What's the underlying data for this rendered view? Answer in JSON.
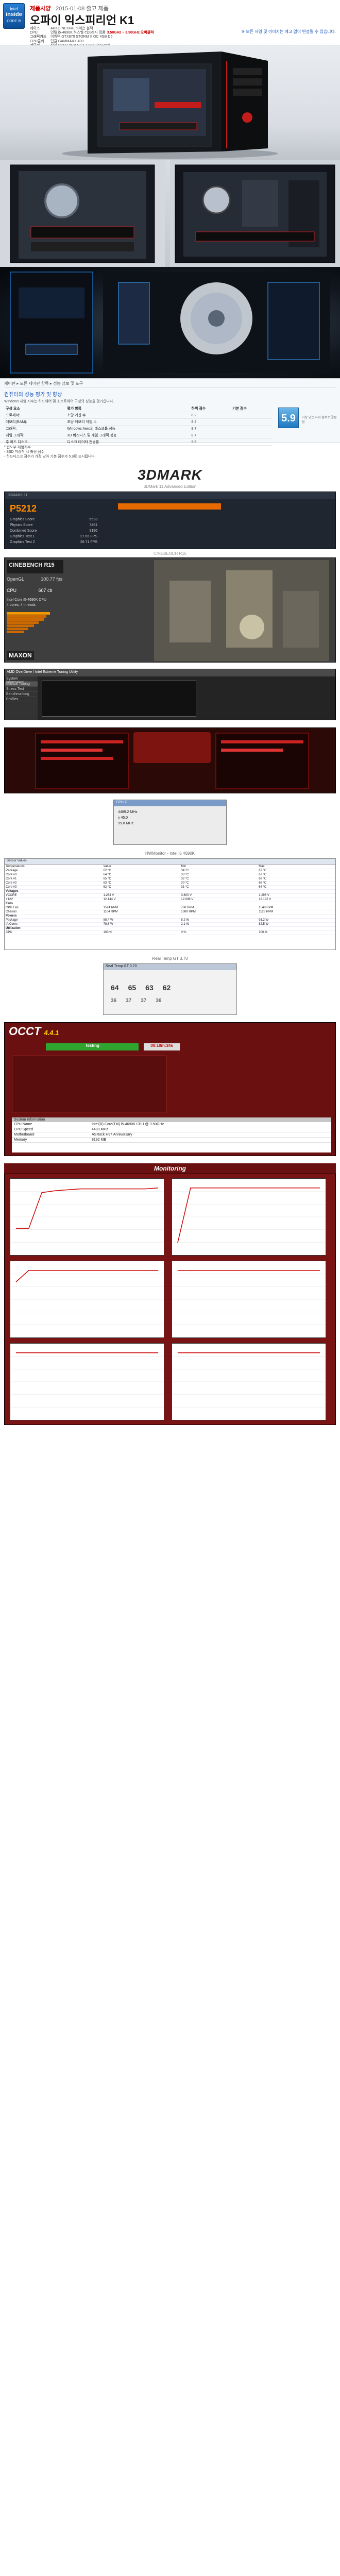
{
  "header": {
    "badge_top": "intel",
    "badge_inside": "inside",
    "badge_brand": "CORE i5",
    "tag": "제품사양",
    "date": "2015-01-08 출고 제품",
    "title": "오파이 익스피리언 K1",
    "note": "※ 모든 사양 및 이미지는 예고 없이 변경될 수 있습니다.",
    "specs": [
      {
        "k": "케이스",
        "v": "ABKO NCORE 바이슨 블랙"
      },
      {
        "k": "CPU",
        "v": "인텔 i5-4690K 하스웰 리프레시 정품",
        "hl": "3.50GHz ~ 3.90GHz 오버클럭"
      },
      {
        "k": "그래픽카드",
        "v": "이엠텍 GTX970 STORM X OC 4GB D5"
      },
      {
        "k": "CPU쿨러",
        "v": "딥쿨 GAMMAXX 400"
      },
      {
        "k": "메모리",
        "v": "삼성 DDR3 8GB PC3-12800 (4GB×2)"
      },
      {
        "k": "파워",
        "v": "마이크로닉스 Classic II 600W 80PLUS"
      },
      {
        "k": "SSD/HDD",
        "v": "샌디스크 SSD 120GB / WD 1TB"
      },
      {
        "k": "메인보드",
        "v": "ASRock H97 Anniversary"
      },
      {
        "k": "CPU/VGA",
        "v": "CPU 오버 / VGA 오버"
      }
    ]
  },
  "photos": {
    "ph1_caption": "",
    "ph2_caption": "",
    "ph3_caption": ""
  },
  "wex": {
    "crumb": "제어판 ▸ 모든 제어판 항목 ▸ 성능 정보 및 도구",
    "heading": "컴퓨터의 성능 평가 및 향상",
    "intro": "Windows 체험 지수는 하드웨어 및 소프트웨어 구성의 성능을 평가합니다.",
    "cols": [
      "구성 요소",
      "평가 항목",
      "하위 점수",
      "기본 점수"
    ],
    "rows": [
      [
        "프로세서:",
        "초당 계산 수",
        "8.2"
      ],
      [
        "메모리(RAM):",
        "초당 메모리 작업 수",
        "8.2"
      ],
      [
        "그래픽:",
        "Windows Aero의 데스크톱 성능",
        "8.7"
      ],
      [
        "게임 그래픽:",
        "3D 비즈니스 및 게임 그래픽 성능",
        "8.7"
      ],
      [
        "주 하드 디스크:",
        "디스크 데이터 전송률",
        "5.9"
      ]
    ],
    "base_score": "5.9",
    "base_caption": "가장 낮은 하위 점수로 결정됨"
  },
  "notes_sm": [
    "* 윈도우 체험지수",
    "- SSD 미장착 시 측정 점수",
    "- 하드디스크 점수가 가장 낮아 기본 점수가 5.9로 표시됩니다."
  ],
  "dmark": {
    "logo": "3DMARK",
    "sub": "3DMark 11 Advanced Edition",
    "topbar": "3DMARK 11",
    "score": "P5212",
    "rows": [
      [
        "Graphics Score",
        "5523"
      ],
      [
        "Physics Score",
        "7461"
      ],
      [
        "Combined Score",
        "3196"
      ],
      [
        "Graphics Test 1",
        "27.65 FPS"
      ],
      [
        "Graphics Test 2",
        "26.71 FPS"
      ]
    ]
  },
  "cinebench": {
    "caption": "CINEBENCH R15",
    "brand": "CINEBENCH R15",
    "opengl_label": "OpenGL",
    "opengl_value": "100.77 fps",
    "cpu_label": "CPU",
    "cpu_value": "607 cb",
    "processor": "Intel Core i5-4690K CPU",
    "cores": "4 cores, 4 threads",
    "maxon": "MAXON"
  },
  "overdrive": {
    "title": "AMD OverDrive / Intel Extreme Tuning Utility",
    "menu": [
      "System Information",
      "Manual Tuning",
      "Stress Test",
      "Benchmarking",
      "Profiles"
    ],
    "active_index": 1
  },
  "cpuz": {
    "title": "CPU-Z",
    "core_speed": "4489.2 MHz",
    "multiplier": "x 45.0",
    "bus": "99.8 MHz"
  },
  "hwmon": {
    "caption": "HWMonitor - Intel i5 4690K",
    "tab": "Sensor Values",
    "rows": [
      [
        "Temperatures",
        "Value",
        "Min",
        "Max"
      ],
      [
        "Package",
        "62 °C",
        "34 °C",
        "67 °C"
      ],
      [
        "Core #0",
        "64 °C",
        "33 °C",
        "67 °C"
      ],
      [
        "Core #1",
        "65 °C",
        "32 °C",
        "68 °C"
      ],
      [
        "Core #2",
        "63 °C",
        "30 °C",
        "66 °C"
      ],
      [
        "Core #3",
        "62 °C",
        "31 °C",
        "64 °C"
      ],
      [
        "Voltages",
        "",
        "",
        ""
      ],
      [
        "VCORE",
        "1.264 V",
        "0.800 V",
        "1.296 V"
      ],
      [
        "+12V",
        "12.144 V",
        "12.096 V",
        "12.192 V"
      ],
      [
        "Fans",
        "",
        "",
        ""
      ],
      [
        "CPU Fan",
        "1524 RPM",
        "768 RPM",
        "1548 RPM"
      ],
      [
        "Chassis",
        "1104 RPM",
        "1080 RPM",
        "1126 RPM"
      ],
      [
        "Powers",
        "",
        "",
        ""
      ],
      [
        "Package",
        "88.4 W",
        "8.2 W",
        "91.2 W"
      ],
      [
        "IA Cores",
        "79.6 W",
        "2.1 W",
        "82.5 W"
      ],
      [
        "Utilization",
        "",
        "",
        ""
      ],
      [
        "CPU",
        "100 %",
        "0 %",
        "100 %"
      ]
    ]
  },
  "realtemp": {
    "caption": "Real Temp GT 3.70",
    "title": "Real Temp GT 3.70",
    "temps": [
      "64",
      "65",
      "63",
      "62"
    ],
    "mins": [
      "36",
      "37",
      "37",
      "36"
    ]
  },
  "occt": {
    "logo": "OCCT",
    "ver": "4.4.1",
    "status": "Testing",
    "elapsed": "00:10m:34s",
    "sys_title": "System Information",
    "sys_rows": [
      [
        "CPU Name",
        "Intel(R) Core(TM) i5-4690K CPU @ 3.50GHz"
      ],
      [
        "CPU Speed",
        "4489 MHz"
      ],
      [
        "Motherboard",
        "ASRock H97 Anniversary"
      ],
      [
        "Memory",
        "8192 MB"
      ]
    ],
    "monitoring": "Monitoring"
  },
  "monitor_graphs": [
    [
      22,
      22,
      60,
      62,
      63,
      64,
      64,
      64,
      64,
      64,
      64,
      65
    ],
    [
      10,
      100,
      100,
      100,
      100,
      100,
      100,
      100,
      100,
      100,
      100,
      100
    ],
    [
      1.02,
      1.26,
      1.26,
      1.26,
      1.26,
      1.26,
      1.26,
      1.26,
      1.26,
      1.26,
      1.26,
      1.26
    ],
    [
      12.1,
      12.1,
      12.1,
      12.1,
      12.1,
      12.1,
      12.1,
      12.1,
      12.1,
      12.1,
      12.1,
      12.1
    ],
    [
      5.0,
      5.0,
      5.0,
      5.0,
      5.0,
      5.0,
      5.0,
      5.0,
      5.0,
      5.0,
      5.0,
      5.0
    ],
    [
      3.3,
      3.3,
      3.3,
      3.3,
      3.3,
      3.3,
      3.3,
      3.3,
      3.3,
      3.3,
      3.3,
      3.3
    ]
  ],
  "colors": {
    "accent_red": "#c00000",
    "brand_blue": "#1a55b8",
    "occt_red": "#6a1010",
    "cinebench_orange": "#f39800"
  }
}
